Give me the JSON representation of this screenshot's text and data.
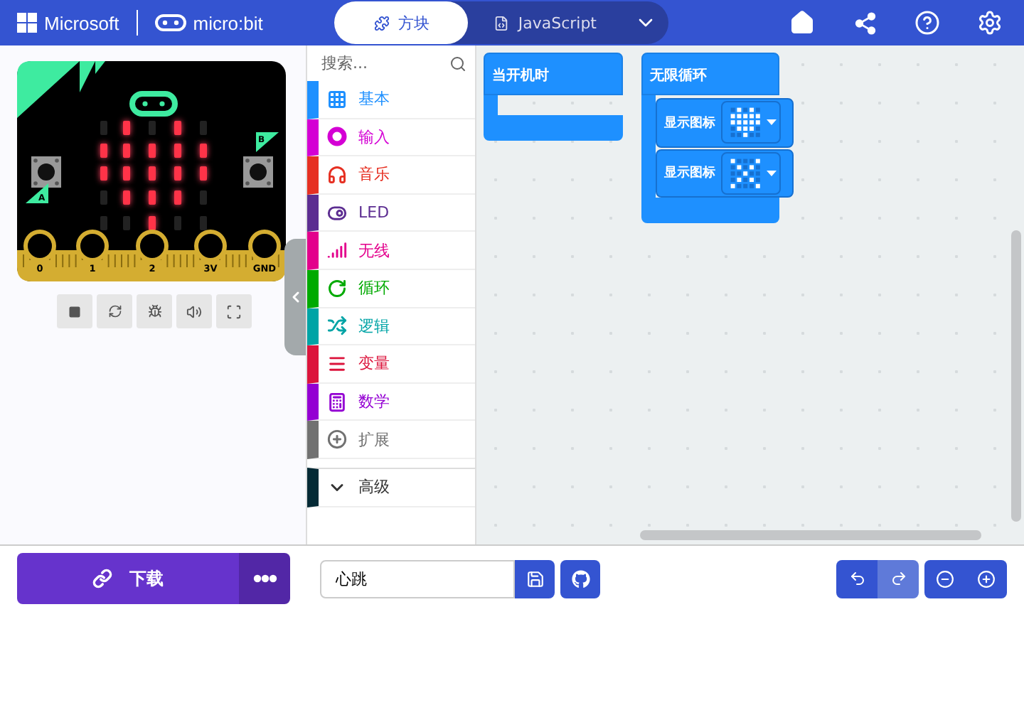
{
  "header": {
    "brand": "Microsoft",
    "product": "micro:bit",
    "tabs": [
      {
        "label": "方块",
        "selected": true
      },
      {
        "label": "JavaScript",
        "selected": false
      }
    ]
  },
  "simulator": {
    "leds": [
      [
        false,
        true,
        false,
        true,
        false
      ],
      [
        true,
        true,
        true,
        true,
        true
      ],
      [
        true,
        true,
        true,
        true,
        true
      ],
      [
        false,
        true,
        true,
        true,
        false
      ],
      [
        false,
        false,
        true,
        false,
        false
      ]
    ],
    "button_labels": [
      "A",
      "B"
    ],
    "pins": [
      "0",
      "1",
      "2",
      "3V",
      "GND"
    ]
  },
  "toolbox": {
    "search_placeholder": "搜索...",
    "categories": [
      {
        "label": "基本",
        "color": "#1e90ff"
      },
      {
        "label": "输入",
        "color": "#d400d4"
      },
      {
        "label": "音乐",
        "color": "#e63022"
      },
      {
        "label": "LED",
        "color": "#5c2d91"
      },
      {
        "label": "无线",
        "color": "#e3008c"
      },
      {
        "label": "循环",
        "color": "#00aa00"
      },
      {
        "label": "逻辑",
        "color": "#00a4a6"
      },
      {
        "label": "变量",
        "color": "#dc143c"
      },
      {
        "label": "数学",
        "color": "#9400d3"
      },
      {
        "label": "扩展",
        "color": "#717171"
      }
    ],
    "advanced": {
      "label": "高级",
      "color": "#042a35"
    }
  },
  "workspace": {
    "on_start": {
      "label": "当开机时"
    },
    "forever": {
      "label": "无限循环",
      "blocks": [
        {
          "label": "显示图标",
          "icon": [
            [
              false,
              true,
              false,
              true,
              false
            ],
            [
              true,
              true,
              true,
              true,
              true
            ],
            [
              true,
              true,
              true,
              true,
              true
            ],
            [
              false,
              true,
              true,
              true,
              false
            ],
            [
              false,
              false,
              true,
              false,
              false
            ]
          ]
        },
        {
          "label": "显示图标",
          "icon": [
            [
              true,
              false,
              false,
              false,
              true
            ],
            [
              false,
              true,
              false,
              true,
              false
            ],
            [
              false,
              false,
              true,
              false,
              false
            ],
            [
              false,
              true,
              false,
              true,
              false
            ],
            [
              true,
              false,
              false,
              false,
              true
            ]
          ]
        }
      ]
    }
  },
  "footer": {
    "download": "下载",
    "project_name": "心跳",
    "undo_disabled": false,
    "redo_disabled": true
  }
}
